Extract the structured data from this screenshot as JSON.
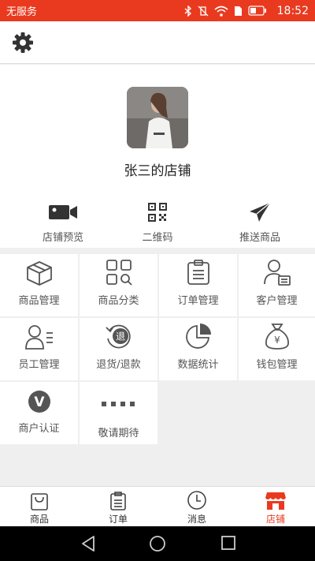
{
  "status_bar": {
    "carrier": "无服务",
    "time": "18:52"
  },
  "profile": {
    "shop_name": "张三的店铺"
  },
  "quick_actions": [
    {
      "label": "店铺预览",
      "icon": "video-camera-icon"
    },
    {
      "label": "二维码",
      "icon": "qr-code-icon"
    },
    {
      "label": "推送商品",
      "icon": "paper-plane-icon"
    }
  ],
  "grid_items": [
    {
      "label": "商品管理",
      "icon": "box-icon"
    },
    {
      "label": "商品分类",
      "icon": "category-icon"
    },
    {
      "label": "订单管理",
      "icon": "clipboard-icon"
    },
    {
      "label": "客户管理",
      "icon": "customer-icon"
    },
    {
      "label": "员工管理",
      "icon": "staff-icon"
    },
    {
      "label": "退货/退款",
      "icon": "refund-icon",
      "badge": "退"
    },
    {
      "label": "数据统计",
      "icon": "pie-chart-icon"
    },
    {
      "label": "钱包管理",
      "icon": "money-bag-icon",
      "badge": "¥"
    },
    {
      "label": "商户认证",
      "icon": "verify-icon",
      "badge": "V"
    },
    {
      "label": "敬请期待",
      "icon": "more-dots-icon"
    }
  ],
  "tabbar": [
    {
      "label": "商品",
      "icon": "shopping-bag-icon"
    },
    {
      "label": "订单",
      "icon": "order-list-icon"
    },
    {
      "label": "消息",
      "icon": "clock-icon"
    },
    {
      "label": "店铺",
      "icon": "store-icon",
      "active": true
    }
  ],
  "colors": {
    "accent": "#e93a1f",
    "icon_gray": "#555555",
    "background": "#efefef"
  }
}
